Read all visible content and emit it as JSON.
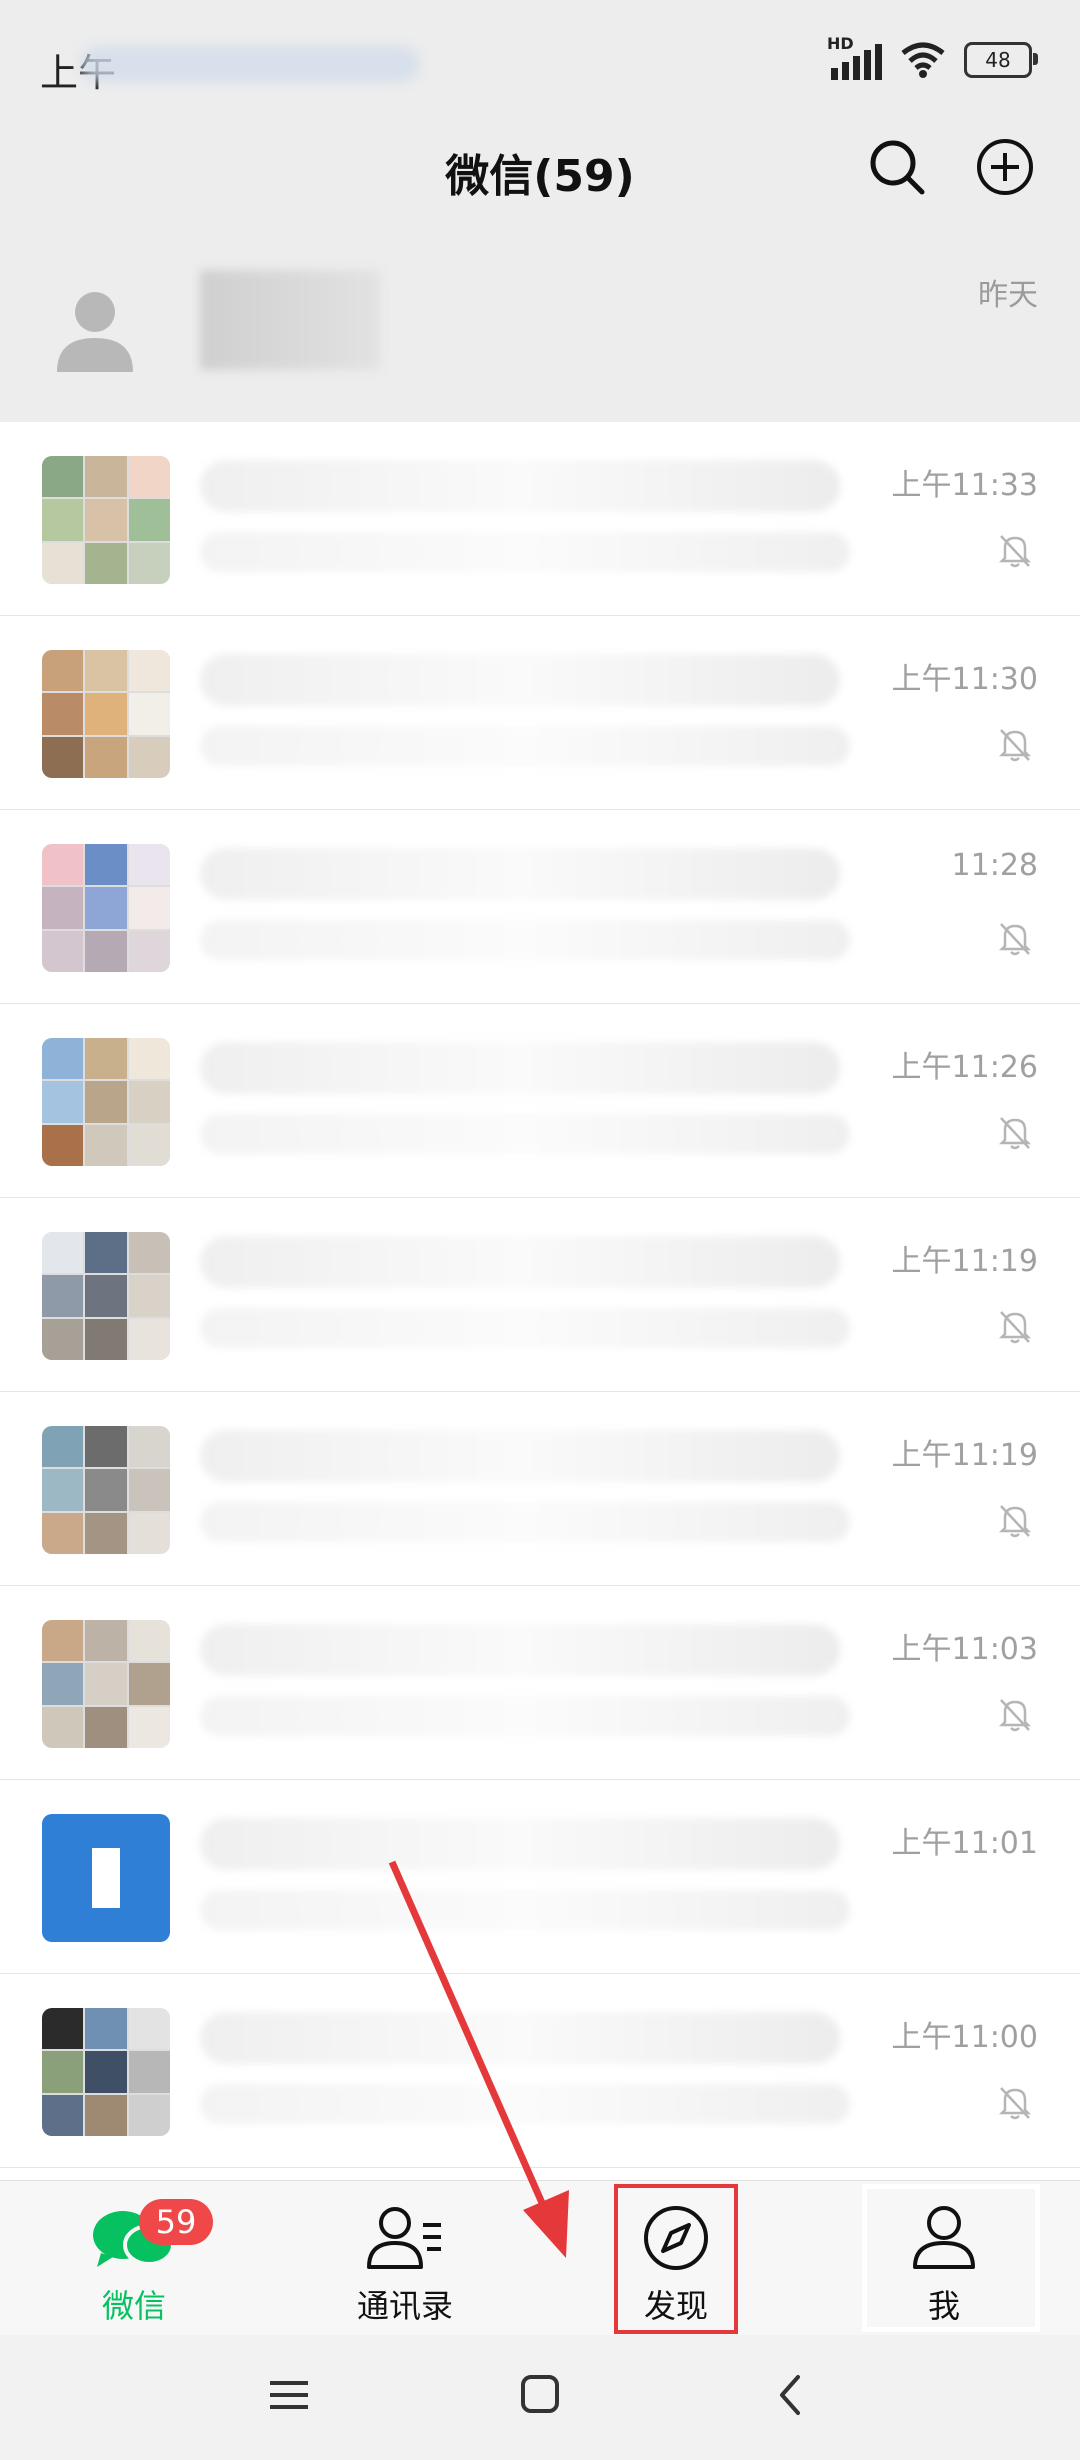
{
  "status_bar": {
    "time_prefix": "上午",
    "network": "HD",
    "battery": "48"
  },
  "header": {
    "title": "微信(59)"
  },
  "pinned_chat": {
    "time": "昨天"
  },
  "chats": [
    {
      "time": "上午11:33",
      "muted": true
    },
    {
      "time": "上午11:30",
      "muted": true
    },
    {
      "time": "11:28",
      "muted": true
    },
    {
      "time": "上午11:26",
      "muted": true
    },
    {
      "time": "上午11:19",
      "muted": true
    },
    {
      "time": "上午11:19",
      "muted": true
    },
    {
      "time": "上午11:03",
      "muted": true
    },
    {
      "time": "上午11:01",
      "muted": false
    },
    {
      "time": "上午11:00",
      "muted": true
    }
  ],
  "tabs": [
    {
      "label": "微信",
      "badge": "59",
      "icon": "chat-bubbles-icon",
      "active": true
    },
    {
      "label": "通讯录",
      "icon": "contacts-icon",
      "active": false
    },
    {
      "label": "发现",
      "icon": "compass-icon",
      "active": false
    },
    {
      "label": "我",
      "icon": "person-icon",
      "active": false
    }
  ],
  "colors": {
    "accent": "#07c160",
    "badge": "#f04848",
    "annotation": "#e5383b",
    "header_bg": "#ededed"
  }
}
